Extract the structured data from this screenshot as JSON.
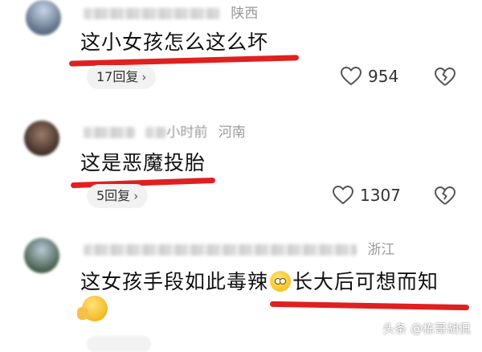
{
  "comments": [
    {
      "location": "陕西",
      "text": "这小女孩怎么这么坏",
      "reply_label": "17回复",
      "likes": "954"
    },
    {
      "location": "河南",
      "time_fragment": "小时前",
      "text": "这是恶魔投胎",
      "reply_label": "5回复",
      "likes": "1307"
    },
    {
      "location": "浙江",
      "text_before_emoji": "这女孩手段如此毒辣",
      "text_after_emoji": "长大后可想而知"
    }
  ],
  "watermark": "头条 @栋哥胡侃",
  "colors": {
    "underline": "#e02020",
    "meta_gray": "#9a9a9a",
    "reply_bg": "#f2f2f2"
  }
}
